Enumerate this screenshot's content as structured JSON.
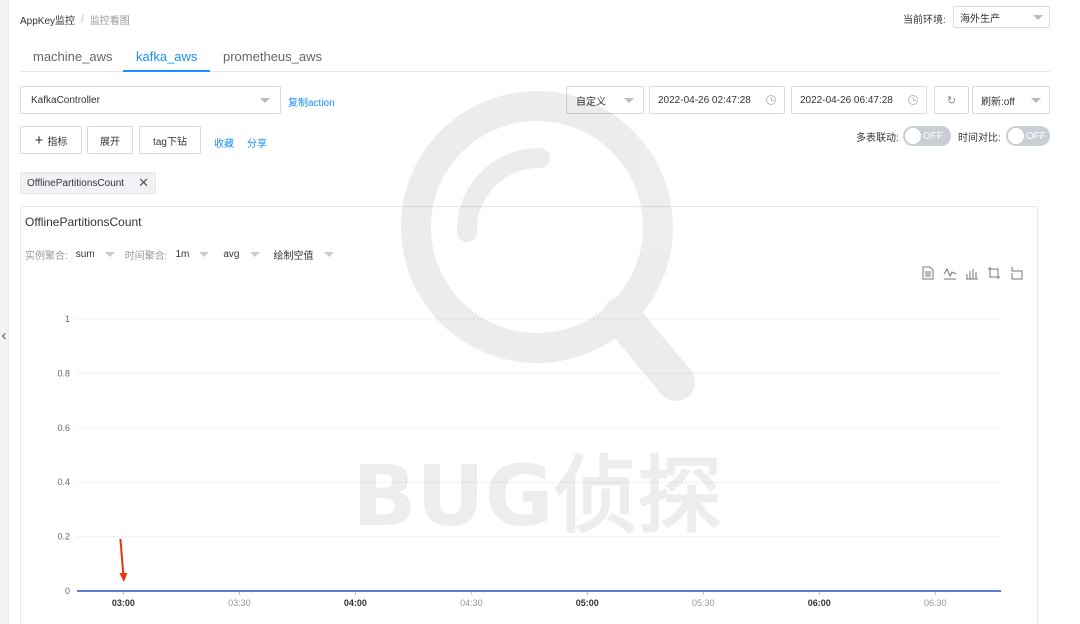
{
  "breadcrumb": {
    "root": "AppKey监控",
    "sep": "/",
    "current": "监控看图"
  },
  "env": {
    "label": "当前环境:",
    "value": "海外生产"
  },
  "tabs": [
    {
      "label": "machine_aws",
      "active": false
    },
    {
      "label": "kafka_aws",
      "active": true
    },
    {
      "label": "prometheus_aws",
      "active": false
    }
  ],
  "toolbar": {
    "controller": "KafkaController",
    "copy_action": "复制action",
    "range": "自定义",
    "start_time": "2022-04-26 02:47:28",
    "end_time": "2022-04-26 06:47:28",
    "refresh_icon": "↻",
    "refresh": "刷新:off",
    "add_metric": "指标",
    "expand": "展开",
    "tag_drill": "tag下钻",
    "favorite": "收藏",
    "share": "分享",
    "linkage_label": "多表联动:",
    "linkage_state": "OFF",
    "compare_label": "时间对比:",
    "compare_state": "OFF"
  },
  "metric_tag": {
    "label": "OfflinePartitionsCount",
    "close": "✕"
  },
  "panel": {
    "title": "OfflinePartitionsCount",
    "instance_agg_label": "实例聚合:",
    "instance_agg_value": "sum",
    "time_agg_label": "时间聚合:",
    "time_agg_value": "1m",
    "func_value": "avg",
    "null_mode": "绘制空值",
    "tool_icons": [
      "document-icon",
      "line-chart-icon",
      "bar-chart-icon",
      "crop-icon",
      "restore-icon"
    ]
  },
  "watermark": {
    "text": "BUG侦探"
  },
  "colors": {
    "accent": "#1890ff",
    "series": "#5b7bd5",
    "annotation_arrow": "#e8340c"
  },
  "chart_data": {
    "type": "line",
    "x": [
      "02:48",
      "03:00",
      "03:30",
      "04:00",
      "04:30",
      "05:00",
      "05:30",
      "06:00",
      "06:30",
      "06:47"
    ],
    "x_ticks": [
      "03:00",
      "03:30",
      "04:00",
      "04:30",
      "05:00",
      "05:30",
      "06:00",
      "06:30"
    ],
    "y_ticks": [
      "0",
      "0.2",
      "0.4",
      "0.6",
      "0.8",
      "1"
    ],
    "series": [
      {
        "values": [
          0,
          0,
          0,
          0,
          0,
          0,
          0,
          0,
          0,
          0
        ]
      }
    ],
    "ylim": [
      0,
      1
    ],
    "grid": true,
    "annotation": {
      "type": "arrow",
      "x": "03:00",
      "y": 0
    }
  }
}
